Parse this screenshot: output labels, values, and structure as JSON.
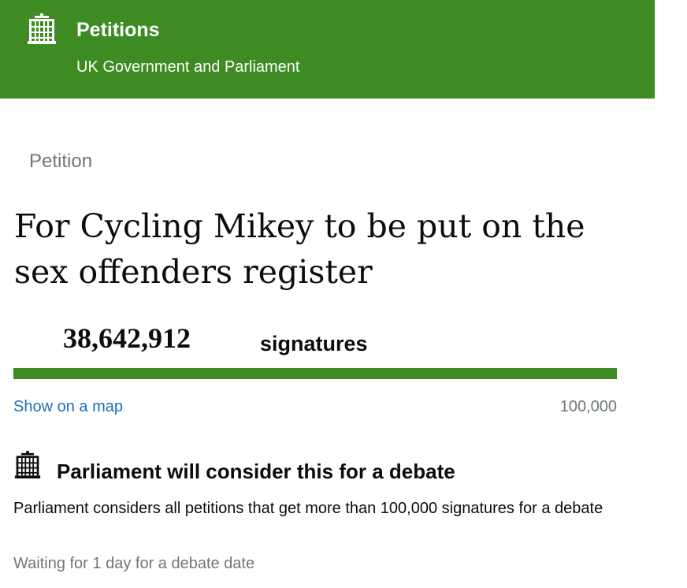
{
  "header": {
    "title": "Petitions",
    "subtitle": "UK Government and Parliament",
    "logo_icon": "portcullis-icon",
    "background_color": "#3d8b22"
  },
  "petition": {
    "kicker": "Petition",
    "title": "For Cycling Mikey to be put on the sex offenders register"
  },
  "signatures": {
    "count": "38,642,912",
    "label": "signatures",
    "progress_fraction": 1.0,
    "progress_color": "#3d8b22"
  },
  "links": {
    "show_map": "Show on a map",
    "threshold": "100,000"
  },
  "debate": {
    "icon": "portcullis-icon",
    "heading": "Parliament will consider this for a debate",
    "text": "Parliament considers all petitions that get more than 100,000 signatures for a debate",
    "waiting": "Waiting for 1 day for a debate date"
  }
}
